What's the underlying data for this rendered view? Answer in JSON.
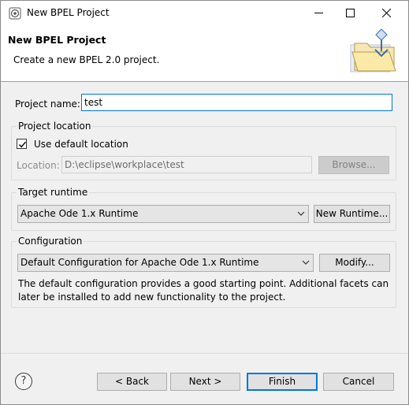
{
  "window": {
    "title": "New BPEL Project",
    "minimize_glyph": "—",
    "maximize_glyph": "☐",
    "close_glyph": "✕"
  },
  "banner": {
    "title": "New BPEL Project",
    "description": "Create a new BPEL 2.0 project.",
    "graphic_icon": "folder-wizard-icon"
  },
  "project_name": {
    "label": "Project name:",
    "value": "test"
  },
  "location": {
    "group_title": "Project location",
    "use_default_label": "Use default location",
    "use_default_checked": true,
    "location_label": "Location:",
    "location_value": "D:\\eclipse\\workplace\\test",
    "browse_label": "Browse..."
  },
  "runtime": {
    "group_title": "Target runtime",
    "selected": "Apache Ode 1.x Runtime",
    "new_runtime_label": "New Runtime..."
  },
  "configuration": {
    "group_title": "Configuration",
    "selected": "Default Configuration for Apache Ode 1.x Runtime",
    "modify_label": "Modify...",
    "description_line1": "The default configuration provides a good starting point. Additional facets can",
    "description_line2": "later be installed to add new functionality to the project."
  },
  "footer": {
    "help_glyph": "?",
    "back_label": "< Back",
    "next_label": "Next >",
    "finish_label": "Finish",
    "cancel_label": "Cancel"
  },
  "colors": {
    "focus_accent": "#0078d7",
    "dialog_background": "#f0f0f0"
  }
}
